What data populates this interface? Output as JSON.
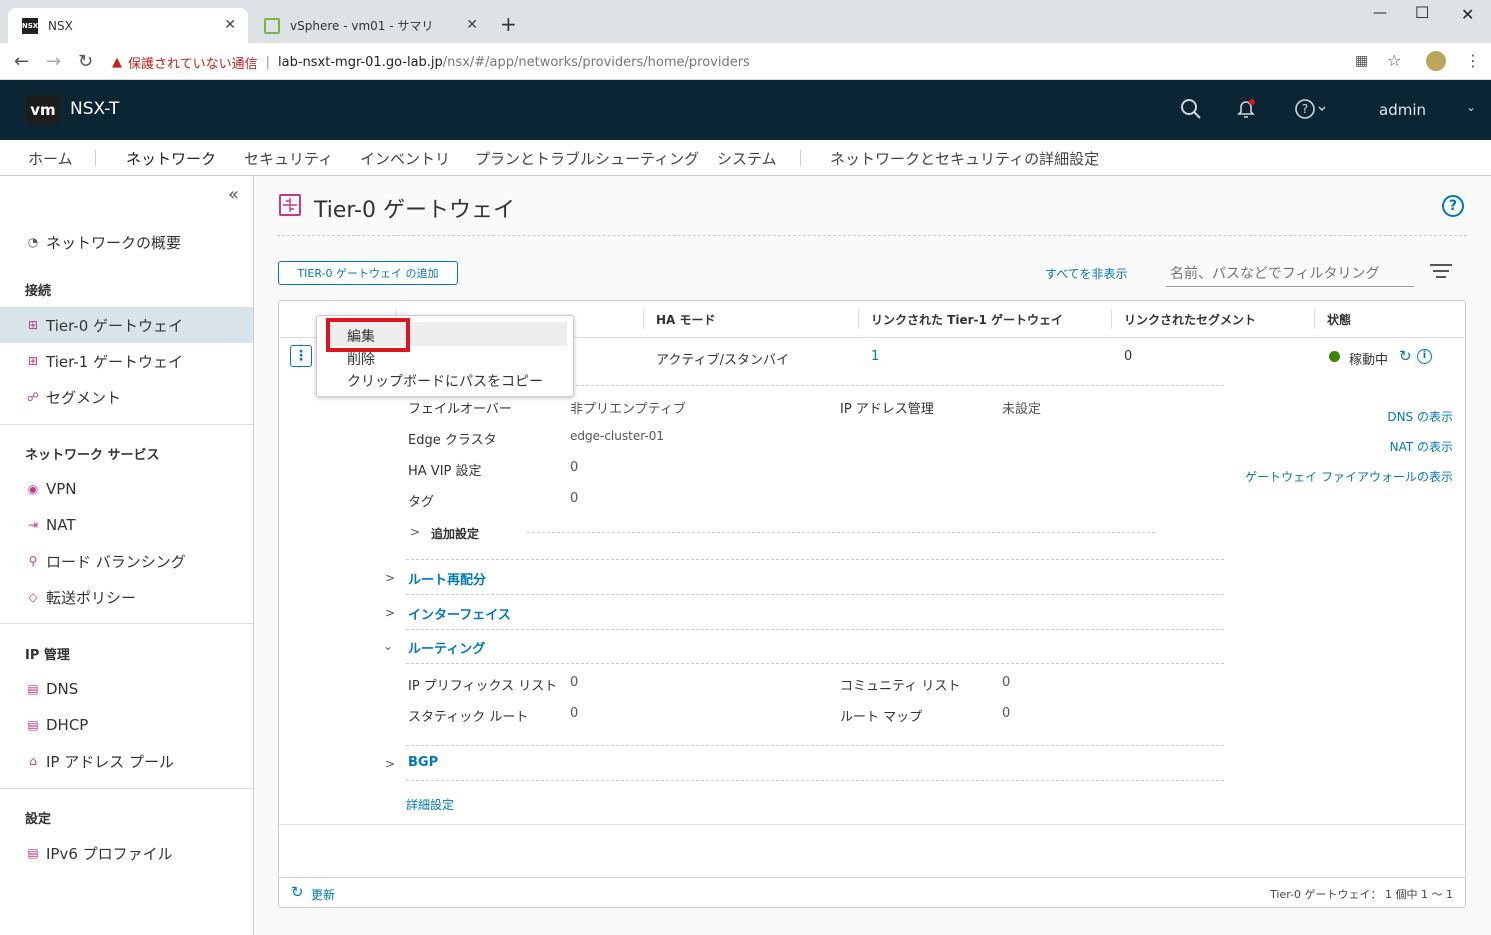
{
  "browser": {
    "tabs": [
      {
        "title": "NSX",
        "favicon": "NSX"
      },
      {
        "title": "vSphere - vm01 - サマリ"
      }
    ],
    "url_warning": "保護されていない通信",
    "url_host": "lab-nsxt-mgr-01.go-lab.jp",
    "url_path": "/nsx/#/app/networks/providers/home/providers"
  },
  "header": {
    "logo": "vm",
    "title": "NSX-T",
    "user": "admin"
  },
  "topnav": [
    "ホーム",
    "ネットワーク",
    "セキュリティ",
    "インベントリ",
    "プランとトラブルシューティング",
    "システム",
    "ネットワークとセキュリティの詳細設定"
  ],
  "sidebar": {
    "overview": "ネットワークの概要",
    "section_connect": "接続",
    "tier0": "Tier-0 ゲートウェイ",
    "tier1": "Tier-1 ゲートウェイ",
    "segment": "セグメント",
    "section_services": "ネットワーク サービス",
    "vpn": "VPN",
    "nat": "NAT",
    "lb": "ロード バランシング",
    "forwarding": "転送ポリシー",
    "section_ip": "IP 管理",
    "dns": "DNS",
    "dhcp": "DHCP",
    "ippool": "IP アドレス プール",
    "section_settings": "設定",
    "ipv6": "IPv6 プロファイル"
  },
  "main": {
    "title": "Tier-0 ゲートウェイ",
    "add_button": "TIER-0 ゲートウェイ の追加",
    "collapse_all": "すべてを非表示",
    "filter_placeholder": "名前、パスなどでフィルタリング",
    "columns": {
      "ha": "HA モード",
      "linked_t1": "リンクされた Tier-1 ゲートウェイ",
      "linked_seg": "リンクされたセグメント",
      "status": "状態"
    },
    "row": {
      "ha": "アクティブ/スタンバイ",
      "linked_t1": "1",
      "linked_seg": "0",
      "status": "稼動中"
    },
    "details": {
      "failover_label": "フェイルオーバー",
      "failover_value": "非プリエンプティブ",
      "ipam_label": "IP アドレス管理",
      "ipam_value": "未設定",
      "edge_label": "Edge クラスタ",
      "edge_value": "edge-cluster-01",
      "havip_label": "HA VIP 設定",
      "havip_value": "0",
      "tag_label": "タグ",
      "tag_value": "0",
      "additional": "追加設定"
    },
    "right_links": {
      "dns": "DNS の表示",
      "nat": "NAT の表示",
      "fw": "ゲートウェイ ファイアウォールの表示"
    },
    "sections": {
      "route_redist": "ルート再配分",
      "interfaces": "インターフェイス",
      "routing": "ルーティング",
      "bgp": "BGP",
      "advanced": "詳細設定"
    },
    "routing": {
      "prefix_label": "IP プリフィックス リスト",
      "prefix_value": "0",
      "community_label": "コミュニティ リスト",
      "community_value": "0",
      "static_label": "スタティック ルート",
      "static_value": "0",
      "routemap_label": "ルート マップ",
      "routemap_value": "0"
    },
    "footer": {
      "refresh": "更新",
      "count": "Tier-0 ゲートウェイ： 1 個中 1 ～ 1"
    }
  },
  "context_menu": {
    "edit": "編集",
    "delete": "削除",
    "copy_path": "クリップボードにパスをコピー"
  },
  "colors": {
    "header_bg": "#0b2535",
    "accent": "#0079b8",
    "status_green": "#3c8500",
    "highlight_red": "#e0141e"
  }
}
